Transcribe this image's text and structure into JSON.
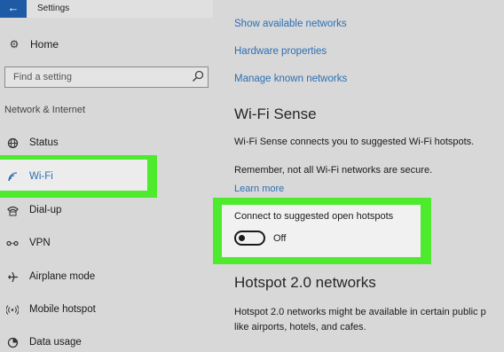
{
  "window": {
    "title": "Settings",
    "back_glyph": "←"
  },
  "sidebar": {
    "home_label": "Home",
    "search_placeholder": "Find a setting",
    "section_header": "Network & Internet",
    "items": [
      {
        "label": "Status",
        "icon": "globe-icon"
      },
      {
        "label": "Wi-Fi",
        "icon": "wifi-icon"
      },
      {
        "label": "Dial-up",
        "icon": "phone-icon"
      },
      {
        "label": "VPN",
        "icon": "vpn-icon"
      },
      {
        "label": "Airplane mode",
        "icon": "airplane-icon"
      },
      {
        "label": "Mobile hotspot",
        "icon": "hotspot-icon"
      },
      {
        "label": "Data usage",
        "icon": "data-usage-icon"
      }
    ]
  },
  "main": {
    "links": [
      "Show available networks",
      "Hardware properties",
      "Manage known networks"
    ],
    "wifi_sense": {
      "heading": "Wi-Fi Sense",
      "description": "Wi-Fi Sense connects you to suggested Wi-Fi hotspots.",
      "warning": "Remember, not all Wi-Fi networks are secure.",
      "learn_more": "Learn more"
    },
    "hotspots": {
      "label": "Connect to suggested open hotspots",
      "toggle_state": "Off"
    },
    "hotspot20": {
      "heading": "Hotspot 2.0 networks",
      "line1": "Hotspot 2.0 networks might be available in certain public p",
      "line2": "like airports, hotels, and cafes."
    }
  },
  "colors": {
    "accent": "#1f5aa6",
    "link": "#2b6fb4",
    "highlight": "#4dea2d"
  }
}
